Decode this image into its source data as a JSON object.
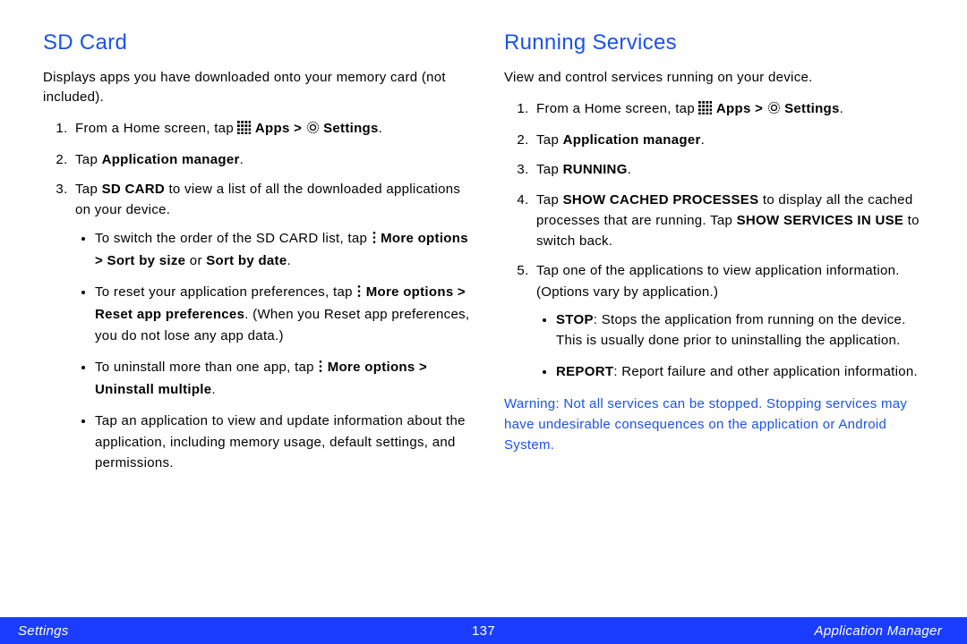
{
  "left": {
    "heading": "SD Card",
    "intro": "Displays apps you have downloaded onto your memory card (not included).",
    "step1_a": "From a Home screen, tap ",
    "step1_b": "Apps > ",
    "step1_c": "Settings",
    "step1_dot": ".",
    "step2_a": "Tap ",
    "step2_b": "Application manager",
    "step2_dot": ".",
    "step3_a": "Tap ",
    "step3_b": "SD CARD",
    "step3_c": " to view a list of all the downloaded applications on your device.",
    "b1_a": "To switch the order of the SD CARD list, tap ",
    "b1_b": "More options > Sort by size",
    "b1_c": " or ",
    "b1_d": "Sort by date",
    "b1_e": ".",
    "b2_a": "To reset your application preferences, tap ",
    "b2_b": "More options > Reset app preferences",
    "b2_c": ". (When you Reset app preferences, you do not lose any app data.)",
    "b3_a": "To uninstall more than one app, tap ",
    "b3_b": "More options > Uninstall multiple",
    "b3_c": ".",
    "b4": "Tap an application to view and update information about the application, including memory usage, default settings, and permissions."
  },
  "right": {
    "heading": "Running Services",
    "intro": "View and control services running on your device.",
    "step1_a": "From a Home screen, tap ",
    "step1_b": "Apps > ",
    "step1_c": "Settings",
    "step1_dot": ".",
    "step2_a": "Tap ",
    "step2_b": "Application manager",
    "step2_dot": ".",
    "step3_a": "Tap ",
    "step3_b": "RUNNING",
    "step3_dot": ".",
    "step4_a": "Tap ",
    "step4_b": "SHOW CACHED PROCESSES",
    "step4_c": " to display all the cached processes that are running. Tap ",
    "step4_d": "SHOW SERVICES IN USE",
    "step4_e": " to switch back.",
    "step5": "Tap one of the applications to view application information. (Options vary by application.)",
    "sb1_a": "STOP",
    "sb1_b": ": Stops the application from running on the device. This is usually done prior to uninstalling the application.",
    "sb2_a": "REPORT",
    "sb2_b": ": Report failure and other application information.",
    "warn_label": "Warning",
    "warn_text": ": Not all services can be stopped. Stopping services may have undesirable consequences on the application or Android System."
  },
  "footer": {
    "left": "Settings",
    "page": "137",
    "right": "Application Manager"
  }
}
